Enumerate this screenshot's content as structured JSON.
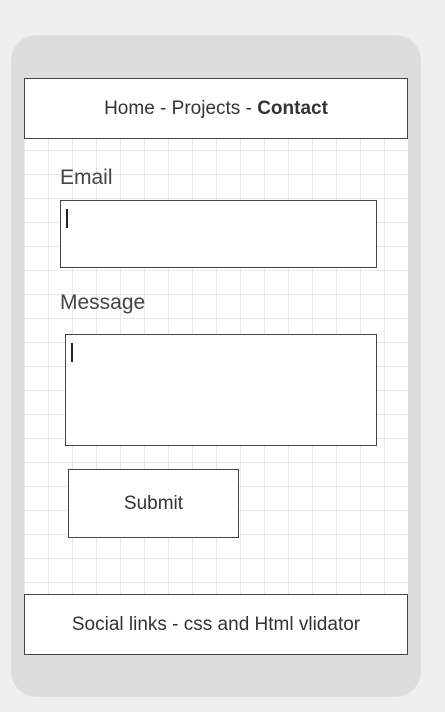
{
  "nav": {
    "items": [
      {
        "label": "Home"
      },
      {
        "label": "Projects"
      },
      {
        "label": "Contact",
        "current": true
      }
    ],
    "separator": " - "
  },
  "form": {
    "email": {
      "label": "Email",
      "value": ""
    },
    "message": {
      "label": "Message",
      "value": ""
    },
    "submit_label": "Submit"
  },
  "footer": {
    "text": "Social links - css and Html vlidator"
  }
}
